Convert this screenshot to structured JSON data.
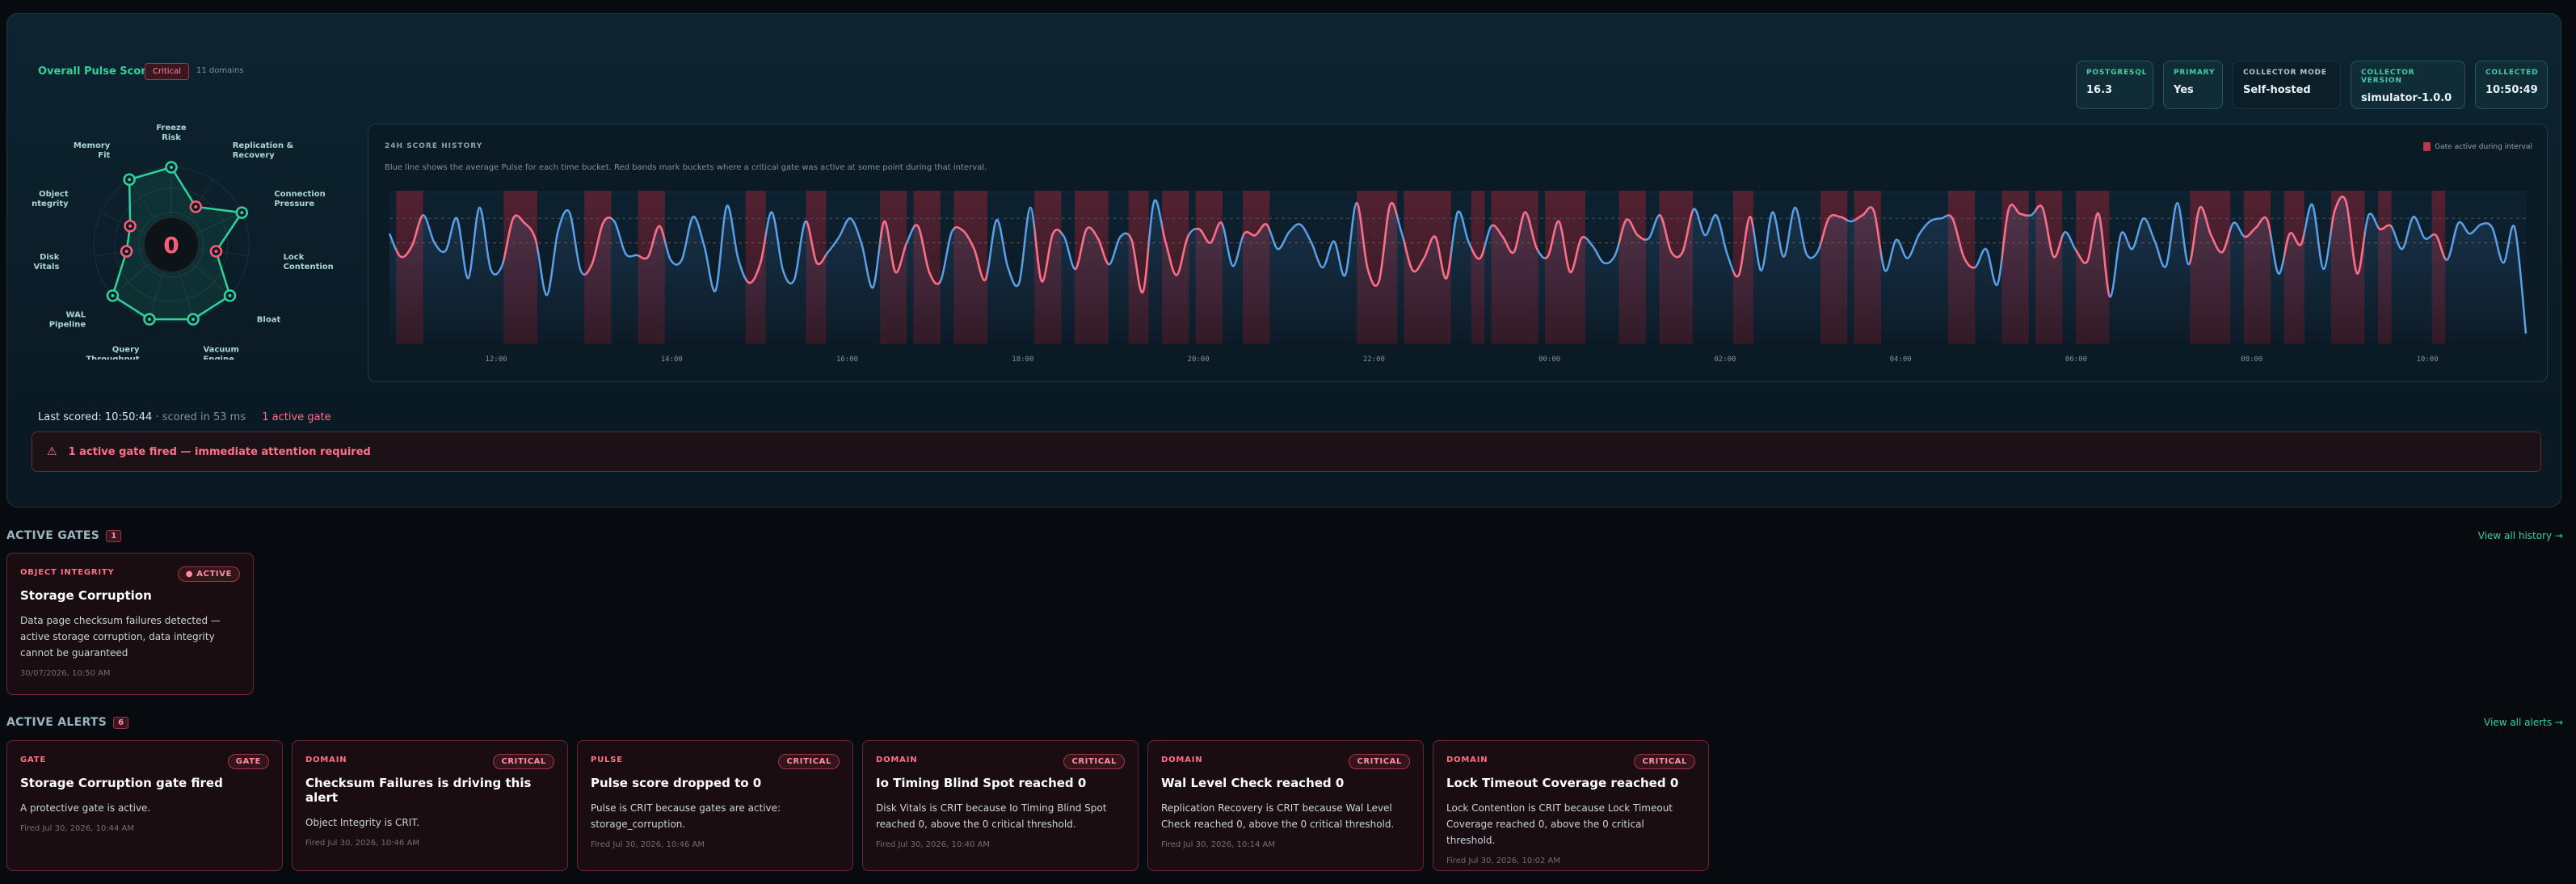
{
  "hero": {
    "title": "Overall Pulse Score",
    "status_chip": "Critical",
    "domains": "11 domains",
    "meta": [
      {
        "label": "POSTGRESQL",
        "value": "16.3"
      },
      {
        "label": "PRIMARY",
        "value": "Yes"
      },
      {
        "label": "COLLECTOR MODE",
        "value": "Self-hosted"
      },
      {
        "label": "COLLECTOR VERSION",
        "value": "simulator-1.0.0"
      },
      {
        "label": "COLLECTED",
        "value": "10:50:49"
      }
    ]
  },
  "radar": {
    "score": "0",
    "domains": [
      {
        "name": "Freeze Risk",
        "status": "ok"
      },
      {
        "name": "Replication & Recovery",
        "status": "crit"
      },
      {
        "name": "Connection Pressure",
        "status": "ok"
      },
      {
        "name": "Lock Contention",
        "status": "crit"
      },
      {
        "name": "Bloat",
        "status": "ok"
      },
      {
        "name": "Vacuum Engine",
        "status": "ok"
      },
      {
        "name": "Query Throughput",
        "status": "ok"
      },
      {
        "name": "WAL Pipeline",
        "status": "ok"
      },
      {
        "name": "Disk Vitals",
        "status": "crit"
      },
      {
        "name": "Object Integrity",
        "status": "crit"
      },
      {
        "name": "Memory Fit",
        "status": "ok"
      }
    ],
    "colors": {
      "ok": "#2fd39a",
      "crit": "#ff5a73"
    }
  },
  "history": {
    "title": "24H SCORE HISTORY",
    "description": "Blue line shows the average Pulse for each time bucket. Red bands mark buckets where a critical gate was active at some point during that interval.",
    "legend": "Gate active during interval",
    "chart_data": {
      "type": "line",
      "x_ticks": [
        "12:00",
        "14:00",
        "16:00",
        "18:00",
        "20:00",
        "22:00",
        "00:00",
        "02:00",
        "04:00",
        "06:00",
        "08:00",
        "10:00"
      ],
      "series": [
        {
          "values": [
            72,
            57,
            64,
            84,
            66,
            61,
            82,
            43,
            89,
            49,
            51,
            82,
            79,
            68,
            32,
            74,
            86,
            48,
            52,
            79,
            80,
            59,
            58,
            57,
            77,
            55,
            55,
            83,
            64,
            35,
            90,
            56,
            40,
            53,
            86,
            48,
            42,
            80,
            53,
            60,
            70,
            82,
            65,
            37,
            80,
            47,
            66,
            77,
            47,
            41,
            73,
            74,
            62,
            42,
            81,
            50,
            40,
            89,
            41,
            72,
            70,
            49,
            75,
            69,
            52,
            70,
            68,
            34,
            93,
            67,
            45,
            70,
            75,
            66,
            79,
            51,
            72,
            71,
            78,
            62,
            73,
            78,
            66,
            50,
            67,
            45,
            92,
            49,
            41,
            91,
            73,
            48,
            56,
            70,
            43,
            86,
            66,
            56,
            77,
            70,
            60,
            86,
            63,
            57,
            80,
            47,
            69,
            64,
            53,
            58,
            81,
            71,
            69,
            84,
            60,
            60,
            88,
            71,
            84,
            58,
            45,
            83,
            48,
            86,
            57,
            89,
            59,
            60,
            82,
            83,
            80,
            84,
            87,
            48,
            68,
            56,
            71,
            80,
            82,
            82,
            57,
            50,
            62,
            39,
            88,
            85,
            84,
            89,
            57,
            73,
            61,
            54,
            85,
            31,
            72,
            62,
            82,
            67,
            51,
            92,
            52,
            89,
            71,
            60,
            79,
            70,
            76,
            81,
            46,
            72,
            65,
            91,
            49,
            87,
            93,
            46,
            84,
            75,
            77,
            62,
            83,
            69,
            71,
            55,
            79,
            72,
            78,
            76,
            53,
            76,
            7
          ]
        }
      ],
      "gate_bands": [
        [
          1,
          5
        ],
        [
          17,
          22
        ],
        [
          29,
          33
        ],
        [
          37,
          41
        ],
        [
          53,
          56
        ],
        [
          62,
          65
        ],
        [
          73,
          77
        ],
        [
          78,
          82
        ],
        [
          84,
          89
        ],
        [
          96,
          100
        ],
        [
          102,
          107
        ],
        [
          110,
          113
        ],
        [
          115,
          119
        ],
        [
          120,
          124
        ],
        [
          127,
          131
        ],
        [
          144,
          150
        ],
        [
          151,
          158
        ],
        [
          161,
          163
        ],
        [
          164,
          171
        ],
        [
          172,
          178
        ],
        [
          183,
          187
        ],
        [
          189,
          194
        ],
        [
          200,
          203
        ],
        [
          213,
          217
        ],
        [
          218,
          222
        ],
        [
          232,
          236
        ],
        [
          240,
          244
        ],
        [
          245,
          249
        ],
        [
          251,
          256
        ],
        [
          268,
          274
        ],
        [
          276,
          280
        ],
        [
          282,
          285
        ],
        [
          289,
          294
        ],
        [
          296,
          298
        ],
        [
          304,
          306
        ]
      ],
      "gate_total": 318,
      "reference_lines": [
        82,
        66
      ],
      "ylim": [
        0,
        100
      ]
    }
  },
  "last_scored": {
    "prefix": "Last scored: 10:50:44",
    "detail": "· scored in 53 ms",
    "gate": "1 active gate"
  },
  "attention": {
    "icon": "⚠",
    "text": "1 active gate fired — immediate attention required"
  },
  "active_gates": {
    "title": "ACTIVE GATES",
    "count": "1",
    "view_all": "View all history →",
    "cards": [
      {
        "kind": "OBJECT INTEGRITY",
        "pill": "● ACTIVE",
        "title": "Storage Corruption",
        "desc": "Data page checksum failures detected — active storage corruption, data integrity cannot be guaranteed",
        "time": "30/07/2026, 10:50 AM"
      }
    ]
  },
  "active_alerts": {
    "title": "ACTIVE ALERTS",
    "count": "6",
    "view_all": "View all alerts →",
    "cards": [
      {
        "kind": "GATE",
        "pill": "GATE",
        "title": "Storage Corruption gate fired",
        "desc": "A protective gate is active.",
        "time": "Fired Jul 30, 2026, 10:44 AM"
      },
      {
        "kind": "DOMAIN",
        "pill": "CRITICAL",
        "title": "Checksum Failures is driving this alert",
        "desc": "Object Integrity is CRIT.",
        "time": "Fired Jul 30, 2026, 10:46 AM"
      },
      {
        "kind": "PULSE",
        "pill": "CRITICAL",
        "title": "Pulse score dropped to 0",
        "desc": "Pulse is CRIT because gates are active: storage_corruption.",
        "time": "Fired Jul 30, 2026, 10:46 AM"
      },
      {
        "kind": "DOMAIN",
        "pill": "CRITICAL",
        "title": "Io Timing Blind Spot reached 0",
        "desc": "Disk Vitals is CRIT because Io Timing Blind Spot reached 0, above the 0 critical threshold.",
        "time": "Fired Jul 30, 2026, 10:40 AM"
      },
      {
        "kind": "DOMAIN",
        "pill": "CRITICAL",
        "title": "Wal Level Check reached 0",
        "desc": "Replication Recovery is CRIT because Wal Level Check reached 0, above the 0 critical threshold.",
        "time": "Fired Jul 30, 2026, 10:14 AM"
      },
      {
        "kind": "DOMAIN",
        "pill": "CRITICAL",
        "title": "Lock Timeout Coverage reached 0",
        "desc": "Lock Contention is CRIT because Lock Timeout Coverage reached 0, above the 0 critical threshold.",
        "time": "Fired Jul 30, 2026, 10:02 AM"
      }
    ]
  }
}
